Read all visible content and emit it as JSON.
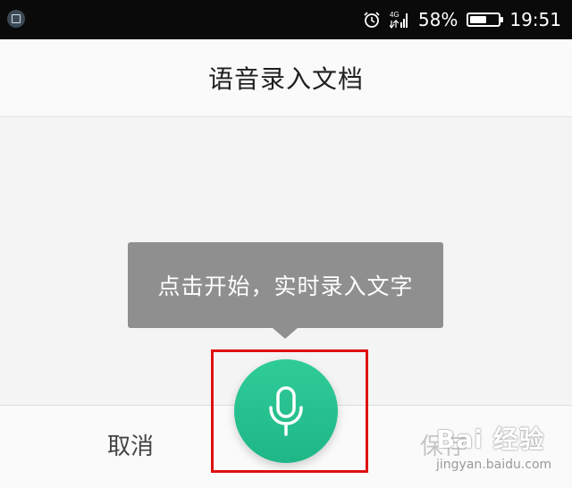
{
  "status_bar": {
    "network": "4G",
    "battery_percent": "58%",
    "battery_level": 0.58,
    "time": "19:51",
    "icons": [
      "screenshot-icon",
      "alarm-icon",
      "signal-icon",
      "battery-icon"
    ]
  },
  "header": {
    "title": "语音录入文档"
  },
  "tooltip": {
    "text": "点击开始，实时录入文字"
  },
  "bottom_bar": {
    "cancel_label": "取消",
    "save_label": "保存"
  },
  "mic_button": {
    "icon": "microphone-icon",
    "color": "#25c28f"
  },
  "highlight_color": "#e01010",
  "watermark": {
    "brand": "Bai 经验",
    "url": "jingyan.baidu.com"
  }
}
